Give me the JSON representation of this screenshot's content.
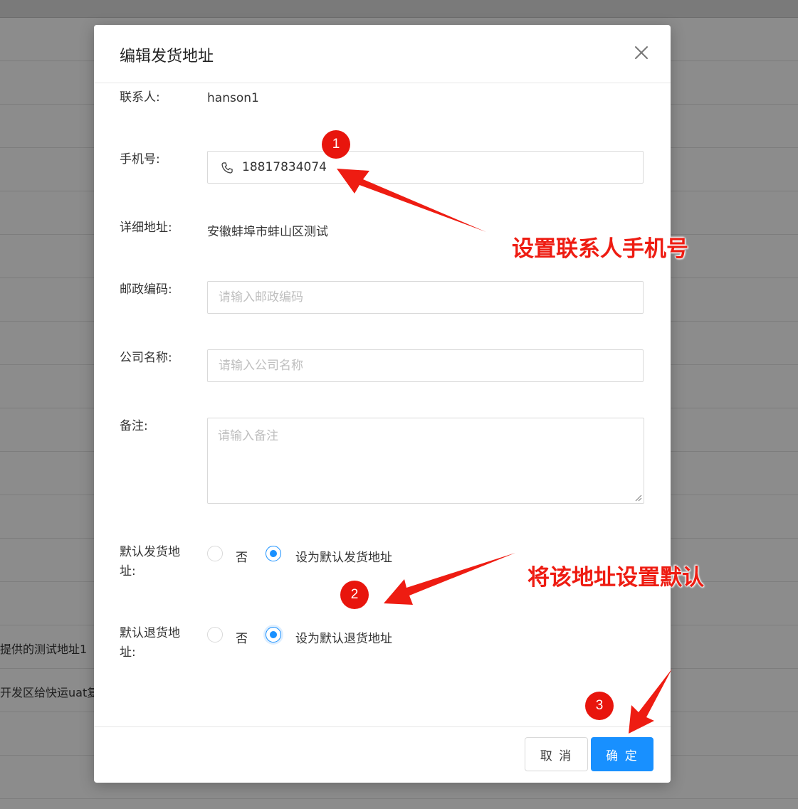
{
  "background": {
    "row_text_1": "提供的测试地址1",
    "row_text_2": "开发区给快运uat复"
  },
  "dialog": {
    "title": "编辑发货地址",
    "close_icon": "close-icon",
    "fields": {
      "contact": {
        "label": "联系人:",
        "value": "hanson1"
      },
      "phone": {
        "label": "手机号:",
        "value": "18817834074",
        "icon": "phone-icon"
      },
      "address": {
        "label": "详细地址:",
        "value": "安徽蚌埠市蚌山区测试"
      },
      "postcode": {
        "label": "邮政编码:",
        "placeholder": "请输入邮政编码"
      },
      "company": {
        "label": "公司名称:",
        "placeholder": "请输入公司名称"
      },
      "remark": {
        "label": "备注:",
        "placeholder": "请输入备注"
      },
      "default_ship": {
        "label_line1": "默认发货地",
        "label_line2": "址:",
        "option_no": "否",
        "option_yes": "设为默认发货地址",
        "selected": "yes"
      },
      "default_return": {
        "label_line1": "默认退货地",
        "label_line2": "址:",
        "option_no": "否",
        "option_yes": "设为默认退货地址",
        "selected": "yes"
      }
    },
    "buttons": {
      "cancel": "取 消",
      "ok": "确 定"
    }
  },
  "annotations": {
    "badge_1": "1",
    "badge_2": "2",
    "badge_3": "3",
    "callout_1": "设置联系人手机号",
    "callout_2": "将该地址设置默认",
    "arrow_color": "#ee1c12"
  },
  "colors": {
    "primary": "#1890ff",
    "mask": "#8c8c8c",
    "annotation_red": "#e8150d"
  }
}
